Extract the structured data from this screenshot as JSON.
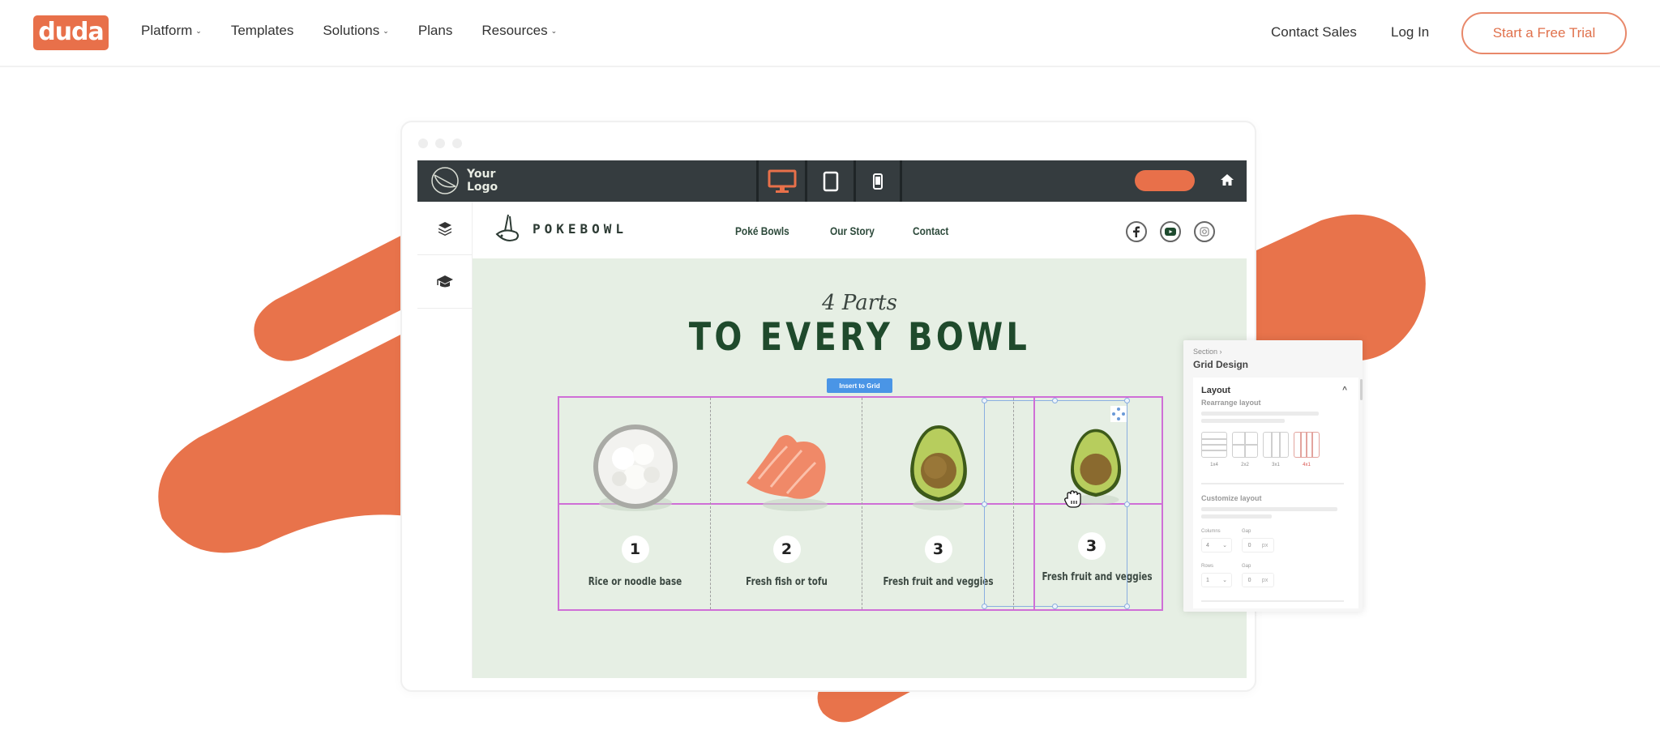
{
  "brand": {
    "logo_text": "duda",
    "accent": "#e8704a"
  },
  "nav": {
    "items": [
      {
        "label": "Platform",
        "has_dropdown": true
      },
      {
        "label": "Templates",
        "has_dropdown": false
      },
      {
        "label": "Solutions",
        "has_dropdown": true
      },
      {
        "label": "Plans",
        "has_dropdown": false
      },
      {
        "label": "Resources",
        "has_dropdown": true
      }
    ],
    "chevron": "⌄",
    "contact_sales": "Contact Sales",
    "log_in": "Log In",
    "cta": "Start a Free Trial"
  },
  "editor": {
    "logo_line1": "Your",
    "logo_line2": "Logo",
    "devices": [
      {
        "name": "desktop",
        "active": true
      },
      {
        "name": "tablet",
        "active": false
      },
      {
        "name": "mobile",
        "active": false
      }
    ],
    "side_tools": [
      "layers-icon",
      "graduation-cap-icon"
    ]
  },
  "site": {
    "brand_name": "POKEBOWL",
    "nav": [
      "Poké Bowls",
      "Our Story",
      "Contact"
    ],
    "socials": [
      "facebook",
      "youtube",
      "instagram"
    ],
    "subtitle": "4 Parts",
    "title": "TO EVERY BOWL",
    "insert_button": "Insert to Grid",
    "items": [
      {
        "number": "1",
        "caption": "Rice or noodle base",
        "food": "rice"
      },
      {
        "number": "2",
        "caption": "Fresh fish or tofu",
        "food": "salmon"
      },
      {
        "number": "3",
        "caption": "Fresh fruit and veggies",
        "food": "avocado"
      }
    ],
    "dragged_item": {
      "number": "3",
      "caption": "Fresh fruit and veggies",
      "food": "avocado"
    }
  },
  "panel": {
    "breadcrumb": "Section ›",
    "title": "Grid Design",
    "layout_section": "Layout",
    "rearrange_label": "Rearrange layout",
    "layout_options": [
      {
        "label": "1x4",
        "active": false
      },
      {
        "label": "2x2",
        "active": false
      },
      {
        "label": "3x1",
        "active": false
      },
      {
        "label": "4x1",
        "active": true
      }
    ],
    "customize_label": "Customize layout",
    "columns_label": "Columns",
    "columns_value": "4",
    "rows_label": "Rows",
    "rows_value": "1",
    "gap_label": "Gap",
    "col_gap_value": "0",
    "row_gap_value": "0",
    "gap_unit": "px",
    "collapse_icon": "^"
  }
}
